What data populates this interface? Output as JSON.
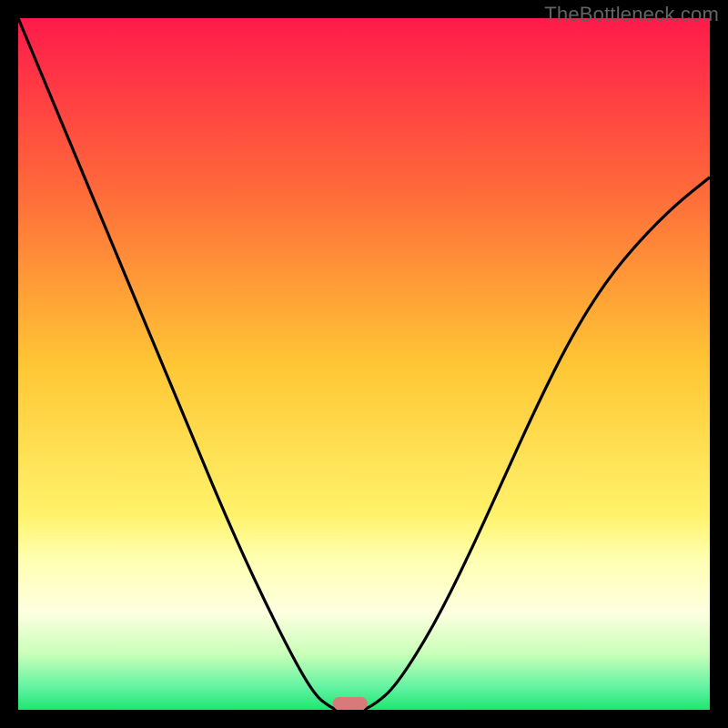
{
  "watermark": "TheBottleneck.com",
  "chart_data": {
    "type": "line",
    "title": "",
    "xlabel": "",
    "ylabel": "",
    "xlim": [
      0,
      100
    ],
    "ylim": [
      0,
      100
    ],
    "grid": false,
    "legend": false,
    "series": [
      {
        "name": "left-curve",
        "x": [
          0,
          5,
          10,
          15,
          20,
          25,
          30,
          35,
          40,
          43,
          45,
          46
        ],
        "y": [
          100,
          88,
          76,
          64,
          52,
          40,
          28,
          17,
          7,
          2,
          0.5,
          0
        ]
      },
      {
        "name": "right-curve",
        "x": [
          50,
          52,
          55,
          60,
          65,
          70,
          75,
          80,
          85,
          90,
          95,
          100
        ],
        "y": [
          0,
          1,
          4,
          12,
          22,
          33,
          44,
          54,
          62,
          68,
          73,
          77
        ]
      }
    ],
    "marker": {
      "x_center": 48,
      "width": 5,
      "color": "#d87a7a"
    },
    "background_gradient": {
      "stops": [
        {
          "offset": 0,
          "color": "#ff1a4b"
        },
        {
          "offset": 25,
          "color": "#ff6a3a"
        },
        {
          "offset": 50,
          "color": "#ffc634"
        },
        {
          "offset": 72,
          "color": "#fff36b"
        },
        {
          "offset": 78,
          "color": "#ffffb0"
        },
        {
          "offset": 86,
          "color": "#fdffe0"
        },
        {
          "offset": 92,
          "color": "#c8ffb8"
        },
        {
          "offset": 97,
          "color": "#5cf2a0"
        },
        {
          "offset": 100,
          "color": "#1ee66f"
        }
      ]
    }
  }
}
